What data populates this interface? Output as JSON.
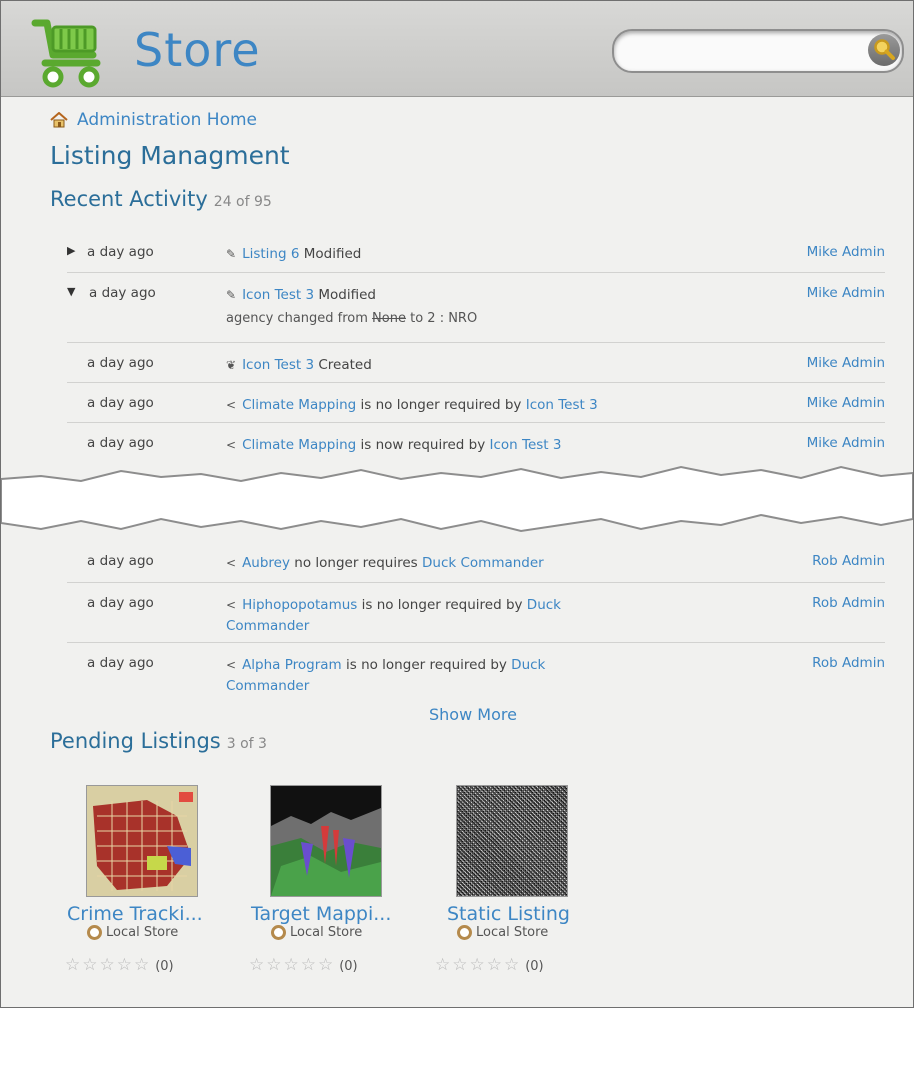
{
  "header": {
    "title": "Store",
    "search_placeholder": "",
    "cart_icon": "shopping-cart-icon",
    "search_icon": "magnifier-icon"
  },
  "breadcrumb": {
    "label": "Administration Home",
    "icon": "home-icon"
  },
  "page_title": "Listing Managment",
  "recent_activity": {
    "title": "Recent Activity",
    "count": "24 of 95",
    "rows_top": [
      {
        "expander": "▶",
        "time": "a day ago",
        "icon": "edit-icon",
        "link": "Listing 6",
        "text": " Modified",
        "user": "Mike  Admin"
      },
      {
        "expander": "▼",
        "time": "a day ago",
        "icon": "edit-icon",
        "link": "Icon Test 3",
        "text": " Modified",
        "user": "Mike  Admin",
        "detail": {
          "prefix": "agency changed from ",
          "old": "None",
          "suffix": " to 2 : NRO"
        }
      },
      {
        "time": "a day ago",
        "icon": "leaf-icon",
        "link": "Icon Test 3",
        "text": " Created",
        "user": "Mike  Admin"
      },
      {
        "time": "a day ago",
        "icon": "share-icon",
        "link": "Climate Mapping",
        "text": " is no longer required by ",
        "link2": "Icon Test 3",
        "user": "Mike  Admin"
      },
      {
        "time": "a day ago",
        "icon": "share-icon",
        "link": "Climate Mapping",
        "text": " is now required by ",
        "link2": "Icon Test 3",
        "user": "Mike  Admin"
      }
    ],
    "rows_bottom": [
      {
        "time": "a day ago",
        "icon": "share-icon",
        "link": "Aubrey",
        "text": " no longer requires ",
        "link2": "Duck Commander",
        "user": "Rob  Admin"
      },
      {
        "time": "a day ago",
        "icon": "share-icon",
        "link": "Hiphopopotamus",
        "text": " is no longer required by ",
        "link2": "Duck Commander",
        "user": "Rob  Admin"
      },
      {
        "time": "a day ago",
        "icon": "share-icon",
        "link": "Alpha Program",
        "text": " is no longer required by ",
        "link2": "Duck Commander",
        "user": "Rob  Admin"
      }
    ],
    "show_more": "Show More"
  },
  "pending": {
    "title": "Pending Listings",
    "count": "3 of 3",
    "cards": [
      {
        "title": "Crime Tracki...",
        "store": "Local Store",
        "ratings": "(0)",
        "thumb": "city-map"
      },
      {
        "title": "Target Mappi...",
        "store": "Local Store",
        "ratings": "(0)",
        "thumb": "terrain"
      },
      {
        "title": "Static Listing",
        "store": "Local Store",
        "ratings": "(0)",
        "thumb": "noise"
      }
    ]
  },
  "colors": {
    "link": "#3d86c4",
    "heading": "#2b6e99",
    "background": "#f1f1ef",
    "cart_green": "#6abf3a"
  }
}
